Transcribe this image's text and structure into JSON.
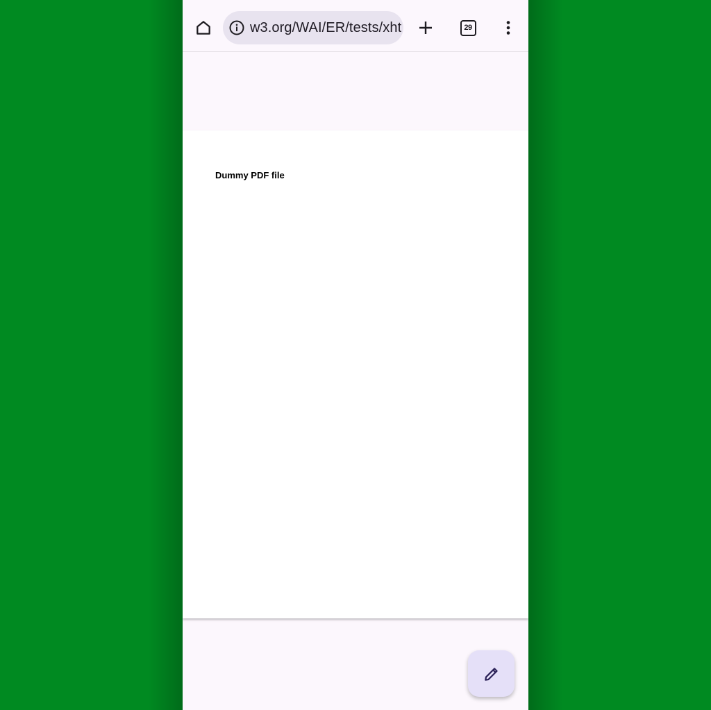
{
  "browser": {
    "url": "w3.org/WAI/ER/tests/xht",
    "tab_count": "29",
    "icons": {
      "home": "home-icon",
      "site_info": "info-icon",
      "new_tab": "plus-icon",
      "tabs": "tab-switcher-icon",
      "menu": "more-vert-icon"
    }
  },
  "document": {
    "title": "Dummy PDF file"
  },
  "fab": {
    "icon": "pencil-icon"
  },
  "colors": {
    "background": "#008a21",
    "toolbar": "#fcf7fd",
    "url_bar": "#e8e3ef",
    "fab": "#e5e0f8",
    "fab_icon": "#2a2157"
  }
}
